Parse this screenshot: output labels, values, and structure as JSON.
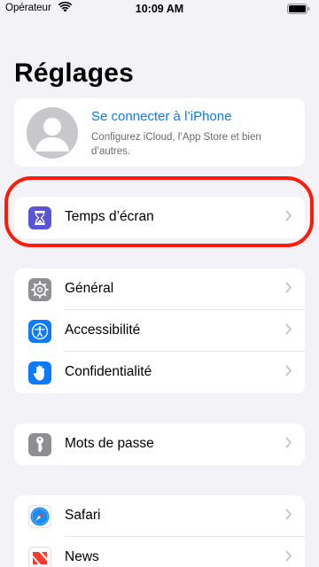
{
  "status_bar": {
    "carrier": "Opérateur",
    "time": "10:09 AM"
  },
  "page_title": "Réglages",
  "profile": {
    "title": "Se connecter à l’iPhone",
    "subtitle": "Configurez iCloud, l’App Store et bien d’autres."
  },
  "groups": {
    "screen_time": {
      "label": "Temps d’écran",
      "icon": "hourglass-icon",
      "color": "#5856d6"
    },
    "general": {
      "items": [
        {
          "label": "Général",
          "icon": "gear-icon",
          "color": "#8e8e93"
        },
        {
          "label": "Accessibilité",
          "icon": "accessibility-icon",
          "color": "#0a7aff"
        },
        {
          "label": "Confidentialité",
          "icon": "hand-icon",
          "color": "#0a7aff"
        }
      ]
    },
    "passwords": {
      "label": "Mots de passe",
      "icon": "key-icon",
      "color": "#8e8e93"
    },
    "apps": {
      "items": [
        {
          "label": "Safari",
          "icon": "compass-icon",
          "color": "#0a7aff"
        },
        {
          "label": "News",
          "icon": "news-icon",
          "color": "#ff3b30"
        }
      ]
    }
  },
  "colors": {
    "accent": "#0a7aff",
    "background": "#f2f2f7",
    "highlight": "#ff1a0a"
  }
}
